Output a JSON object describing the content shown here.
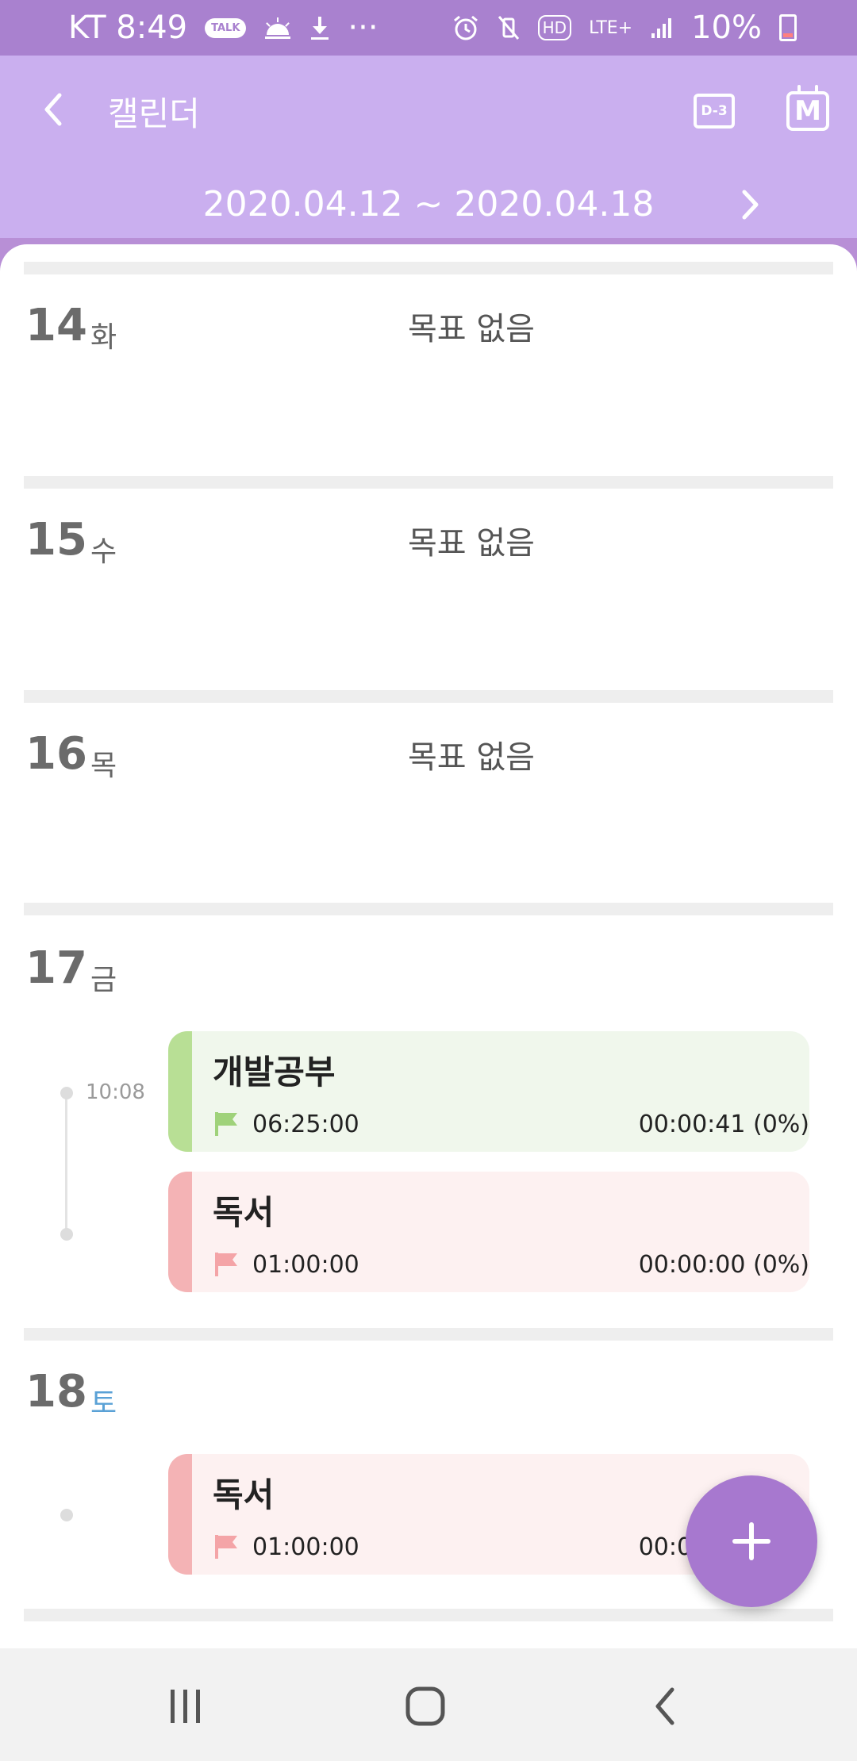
{
  "status_bar": {
    "carrier_time": "KT 8:49",
    "talk_badge": "TALK",
    "more": "···",
    "network": "LTE+",
    "hd": "HD",
    "battery": "10%"
  },
  "header": {
    "title": "캘린더",
    "dday_label": "D-3",
    "month_label": "M"
  },
  "week": {
    "range": "2020.04.12 ~ 2020.04.18"
  },
  "days": [
    {
      "num": "14",
      "weekday": "화",
      "empty_text": "목표 없음"
    },
    {
      "num": "15",
      "weekday": "수",
      "empty_text": "목표 없음"
    },
    {
      "num": "16",
      "weekday": "목",
      "empty_text": "목표 없음"
    },
    {
      "num": "17",
      "weekday": "금",
      "time": "10:08",
      "tasks": [
        {
          "name": "개발공부",
          "goal": "06:25:00",
          "record": "00:00:41 (0%)",
          "color": "#b8df95"
        },
        {
          "name": "독서",
          "goal": "01:00:00",
          "record": "00:00:00 (0%)",
          "color": "#f4b3b5"
        }
      ]
    },
    {
      "num": "18",
      "weekday": "토",
      "tasks": [
        {
          "name": "독서",
          "goal": "01:00:00",
          "record": "00:00:00 (0%)",
          "color": "#f4b3b5"
        }
      ]
    }
  ],
  "colors": {
    "status_bar": "#a981cf",
    "header": "#caafef",
    "fab": "#a778cf",
    "saturday": "#5aa1d6"
  },
  "icons": [
    "back-arrow-icon",
    "d-day-icon",
    "month-calendar-icon",
    "next-arrow-icon",
    "flag-icon",
    "plus-icon",
    "recent-apps-icon",
    "home-icon",
    "nav-back-icon"
  ]
}
